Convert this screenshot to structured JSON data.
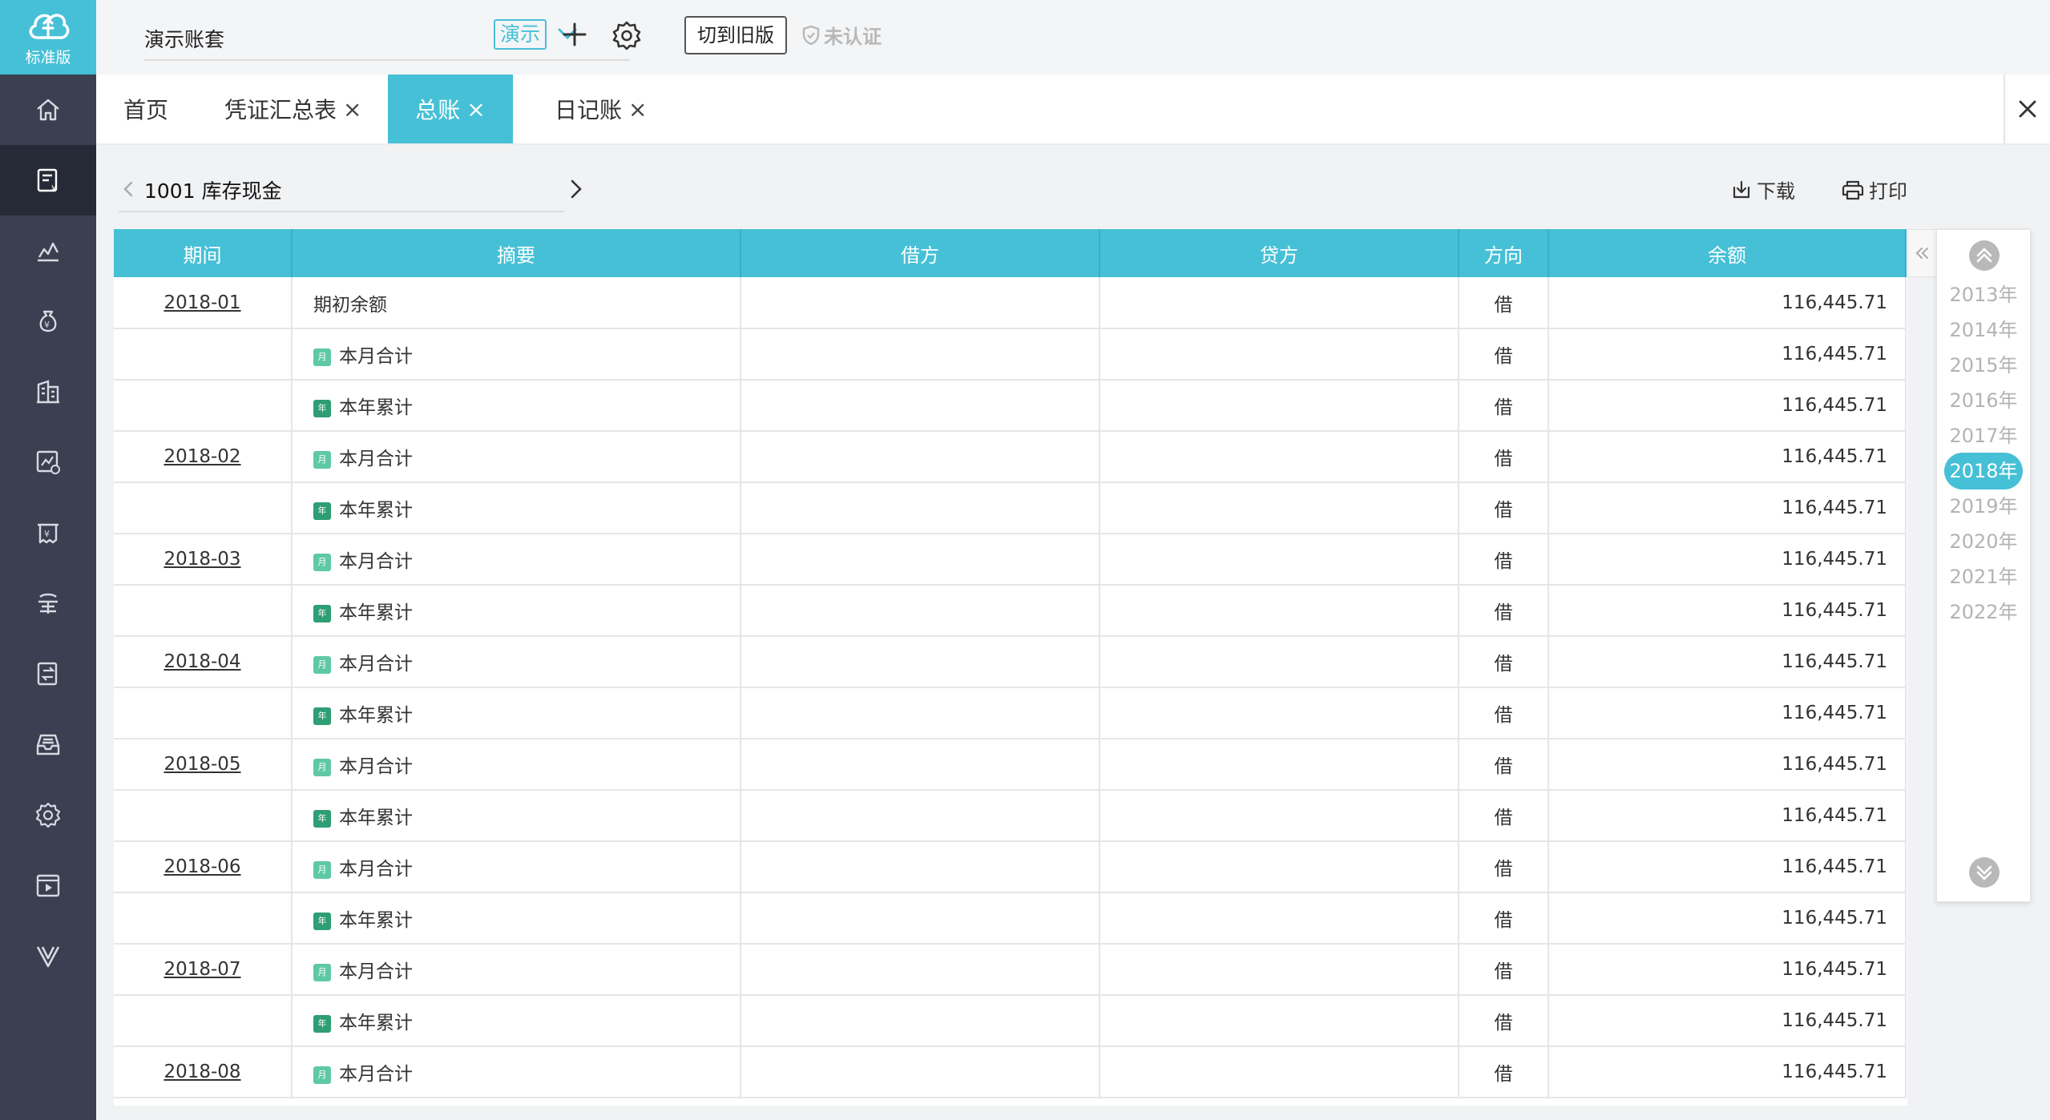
{
  "logo": {
    "label": "标准版"
  },
  "sidebar": {
    "items": [
      {
        "icon": "home-icon"
      },
      {
        "icon": "voucher-icon",
        "active": true
      },
      {
        "icon": "chart-icon"
      },
      {
        "icon": "money-bag-icon"
      },
      {
        "icon": "building-icon"
      },
      {
        "icon": "report-icon"
      },
      {
        "icon": "invoice-icon"
      },
      {
        "icon": "tax-icon"
      },
      {
        "icon": "transfer-icon"
      },
      {
        "icon": "archive-icon"
      },
      {
        "icon": "settings-icon"
      },
      {
        "icon": "video-icon"
      },
      {
        "icon": "vip-icon"
      }
    ]
  },
  "topbar": {
    "account_name": "演示账套",
    "demo_tag": "演示",
    "switch_label": "切到旧版",
    "cert_status": "未认证"
  },
  "tabs": [
    {
      "label": "首页",
      "closable": false
    },
    {
      "label": "凭证汇总表",
      "closable": true
    },
    {
      "label": "总账",
      "closable": true,
      "active": true
    },
    {
      "label": "日记账",
      "closable": true
    }
  ],
  "tab_close_symbol": "×",
  "subject": {
    "name": "1001 库存现金"
  },
  "toolbar": {
    "download_label": "下载",
    "print_label": "打印"
  },
  "table": {
    "columns": [
      "期间",
      "摘要",
      "借方",
      "贷方",
      "方向",
      "余额"
    ],
    "month_badge": "月",
    "year_badge": "年",
    "rows": [
      {
        "period": "2018-01",
        "summary": "期初余额",
        "badge": "",
        "debit": "",
        "credit": "",
        "direction": "借",
        "balance": "116,445.71"
      },
      {
        "period": "",
        "summary": "本月合计",
        "badge": "month",
        "debit": "",
        "credit": "",
        "direction": "借",
        "balance": "116,445.71"
      },
      {
        "period": "",
        "summary": "本年累计",
        "badge": "year",
        "debit": "",
        "credit": "",
        "direction": "借",
        "balance": "116,445.71"
      },
      {
        "period": "2018-02",
        "summary": "本月合计",
        "badge": "month",
        "debit": "",
        "credit": "",
        "direction": "借",
        "balance": "116,445.71"
      },
      {
        "period": "",
        "summary": "本年累计",
        "badge": "year",
        "debit": "",
        "credit": "",
        "direction": "借",
        "balance": "116,445.71"
      },
      {
        "period": "2018-03",
        "summary": "本月合计",
        "badge": "month",
        "debit": "",
        "credit": "",
        "direction": "借",
        "balance": "116,445.71"
      },
      {
        "period": "",
        "summary": "本年累计",
        "badge": "year",
        "debit": "",
        "credit": "",
        "direction": "借",
        "balance": "116,445.71"
      },
      {
        "period": "2018-04",
        "summary": "本月合计",
        "badge": "month",
        "debit": "",
        "credit": "",
        "direction": "借",
        "balance": "116,445.71"
      },
      {
        "period": "",
        "summary": "本年累计",
        "badge": "year",
        "debit": "",
        "credit": "",
        "direction": "借",
        "balance": "116,445.71"
      },
      {
        "period": "2018-05",
        "summary": "本月合计",
        "badge": "month",
        "debit": "",
        "credit": "",
        "direction": "借",
        "balance": "116,445.71"
      },
      {
        "period": "",
        "summary": "本年累计",
        "badge": "year",
        "debit": "",
        "credit": "",
        "direction": "借",
        "balance": "116,445.71"
      },
      {
        "period": "2018-06",
        "summary": "本月合计",
        "badge": "month",
        "debit": "",
        "credit": "",
        "direction": "借",
        "balance": "116,445.71"
      },
      {
        "period": "",
        "summary": "本年累计",
        "badge": "year",
        "debit": "",
        "credit": "",
        "direction": "借",
        "balance": "116,445.71"
      },
      {
        "period": "2018-07",
        "summary": "本月合计",
        "badge": "month",
        "debit": "",
        "credit": "",
        "direction": "借",
        "balance": "116,445.71"
      },
      {
        "period": "",
        "summary": "本年累计",
        "badge": "year",
        "debit": "",
        "credit": "",
        "direction": "借",
        "balance": "116,445.71"
      },
      {
        "period": "2018-08",
        "summary": "本月合计",
        "badge": "month",
        "debit": "",
        "credit": "",
        "direction": "借",
        "balance": "116,445.71"
      }
    ]
  },
  "years": {
    "items": [
      "2013年",
      "2014年",
      "2015年",
      "2016年",
      "2017年",
      "2018年",
      "2019年",
      "2020年",
      "2021年",
      "2022年"
    ],
    "selected": "2018年"
  },
  "colors": {
    "accent": "#46c0d6",
    "sidebar": "#3a3f51",
    "sidebar_active": "#262a36",
    "month_badge": "#5fc9a4",
    "year_badge": "#2e9e74"
  }
}
